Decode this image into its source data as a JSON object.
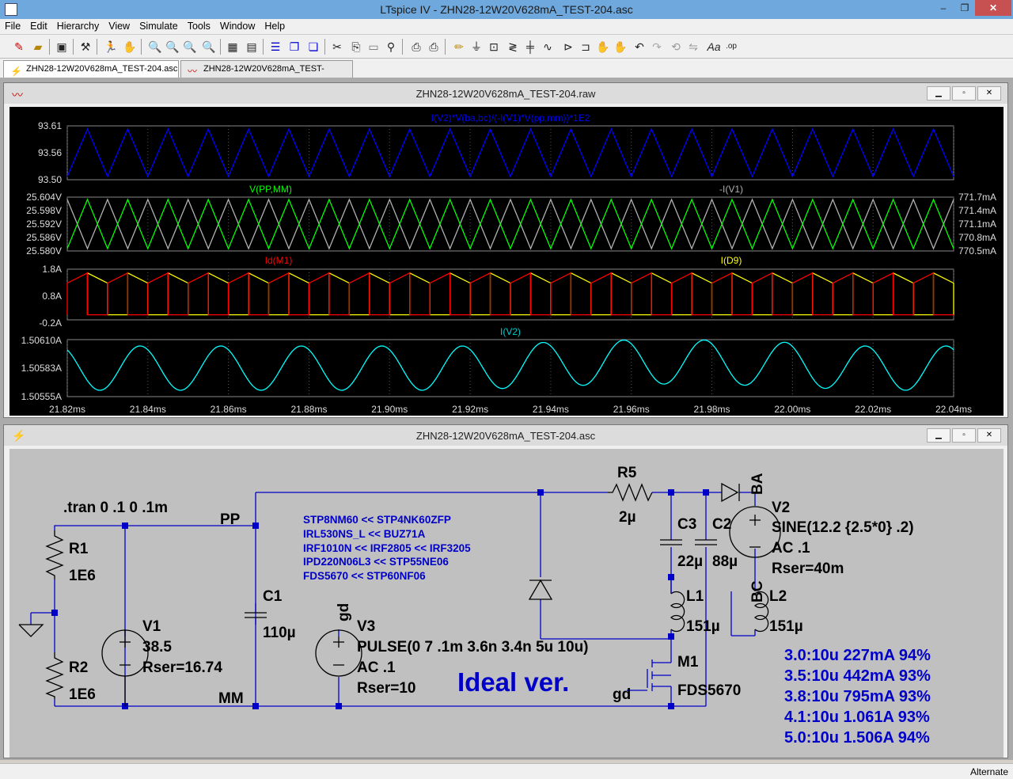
{
  "app": {
    "title": "LTspice IV - ZHN28-12W20V628mA_TEST-204.asc",
    "min_label": "–",
    "max_label": "❐",
    "close_label": "✕"
  },
  "menu": [
    "File",
    "Edit",
    "Hierarchy",
    "View",
    "Simulate",
    "Tools",
    "Window",
    "Help"
  ],
  "tabs": [
    {
      "label": "ZHN28-12W20V628mA_TEST-204.asc",
      "active": true
    },
    {
      "label": "ZHN28-12W20V628mA_TEST-204.raw",
      "active": false
    }
  ],
  "plot_window": {
    "title": "ZHN28-12W20V628mA_TEST-204.raw"
  },
  "schematic_window": {
    "title": "ZHN28-12W20V628mA_TEST-204.asc"
  },
  "status": {
    "mode": "Alternate"
  },
  "chart_data": [
    {
      "type": "line",
      "pane": 1,
      "title": "I(V2)*V(ba,bc)/(-I(V1)*V(pp,mm))*1E2",
      "yticks": [
        "93.61",
        "93.56",
        "93.50"
      ],
      "ylim": [
        93.5,
        93.61
      ],
      "series": [
        {
          "name": "I(V2)*V(ba,bc)/(-I(V1)*V(pp,mm))*1E2",
          "color": "#0000ff",
          "shape": "triangle",
          "periods": 22,
          "min": 93.5,
          "max": 93.6
        }
      ]
    },
    {
      "type": "line",
      "pane": 2,
      "left_yticks": [
        "25.604V",
        "25.598V",
        "25.592V",
        "25.586V",
        "25.580V"
      ],
      "right_yticks": [
        "771.7mA",
        "771.4mA",
        "771.1mA",
        "770.8mA",
        "770.5mA"
      ],
      "series": [
        {
          "name": "V(PP,MM)",
          "color": "#00ff00",
          "shape": "triangle",
          "periods": 22,
          "min": 25.581,
          "max": 25.603
        },
        {
          "name": "-I(V1)",
          "color": "#b0b0b0",
          "shape": "triangle-inverted",
          "periods": 22,
          "min": 770.6,
          "max": 771.6
        }
      ]
    },
    {
      "type": "line",
      "pane": 3,
      "yticks": [
        "1.8A",
        "0.8A",
        "-0.2A"
      ],
      "ylim": [
        -0.2,
        1.8
      ],
      "series": [
        {
          "name": "Id(M1)",
          "color": "#ff0000",
          "shape": "ramp-up",
          "periods": 22,
          "min": 0.0,
          "max": 1.65
        },
        {
          "name": "I(D9)",
          "color": "#ffff00",
          "shape": "ramp-down",
          "periods": 22,
          "min": 0.0,
          "max": 1.65
        }
      ]
    },
    {
      "type": "line",
      "pane": 4,
      "title": "I(V2)",
      "yticks": [
        "1.50610A",
        "1.50583A",
        "1.50555A"
      ],
      "ylim": [
        1.50555,
        1.5061
      ],
      "series": [
        {
          "name": "I(V2)",
          "color": "#00ffff",
          "shape": "sine",
          "cycles": 11,
          "min": 1.5056,
          "max": 1.50605
        }
      ]
    }
  ],
  "xaxis": {
    "ticks": [
      "21.82ms",
      "21.84ms",
      "21.86ms",
      "21.88ms",
      "21.90ms",
      "21.92ms",
      "21.94ms",
      "21.96ms",
      "21.98ms",
      "22.00ms",
      "22.02ms",
      "22.04ms"
    ],
    "xlim": [
      21.82,
      22.04
    ]
  },
  "schematic": {
    "directive": ".tran 0 .1 0 .1m",
    "net_pp": "PP",
    "net_mm": "MM",
    "net_gd": "gd",
    "net_gd2": "gd",
    "net_ba": "BA",
    "net_bc": "BC",
    "r1_name": "R1",
    "r1_value": "1E6",
    "r2_name": "R2",
    "r2_value": "1E6",
    "v1_name": "V1",
    "v1_value": "38.5",
    "v1_rser": "Rser=16.74",
    "c1_name": "C1",
    "c1_value": "110µ",
    "v3_name": "V3",
    "v3_value": "PULSE(0 7 .1m 3.6n 3.4n 5u 10u)",
    "v3_ac": "AC .1",
    "v3_rser": "Rser=10",
    "r5_name": "R5",
    "r5_value": "2µ",
    "c3_name": "C3",
    "c3_value": "22µ",
    "c2_name": "C2",
    "c2_value": "88µ",
    "v2_name": "V2",
    "v2_value": "SINE(12.2 {2.5*0} .2)",
    "v2_ac": "AC .1",
    "v2_rser": "Rser=40m",
    "l1_name": "L1",
    "l1_value": "151µ",
    "l2_name": "L2",
    "l2_value": "151µ",
    "m1_name": "M1",
    "m1_value": "FDS5670",
    "ideal_label": "Ideal ver.",
    "mosfet_notes": [
      "STP8NM60 << STP4NK60ZFP",
      "IRL530NS_L << BUZ71A",
      "IRF1010N << IRF2805 << IRF3205",
      "IPD220N06L3 << STP55NE06",
      "FDS5670 << STP60NF06"
    ],
    "results": [
      "3.0:10u 227mA 94%",
      "3.5:10u 442mA 93%",
      "3.8:10u 795mA 93%",
      "4.1:10u 1.061A 93%",
      "5.0:10u 1.506A 94%"
    ]
  }
}
